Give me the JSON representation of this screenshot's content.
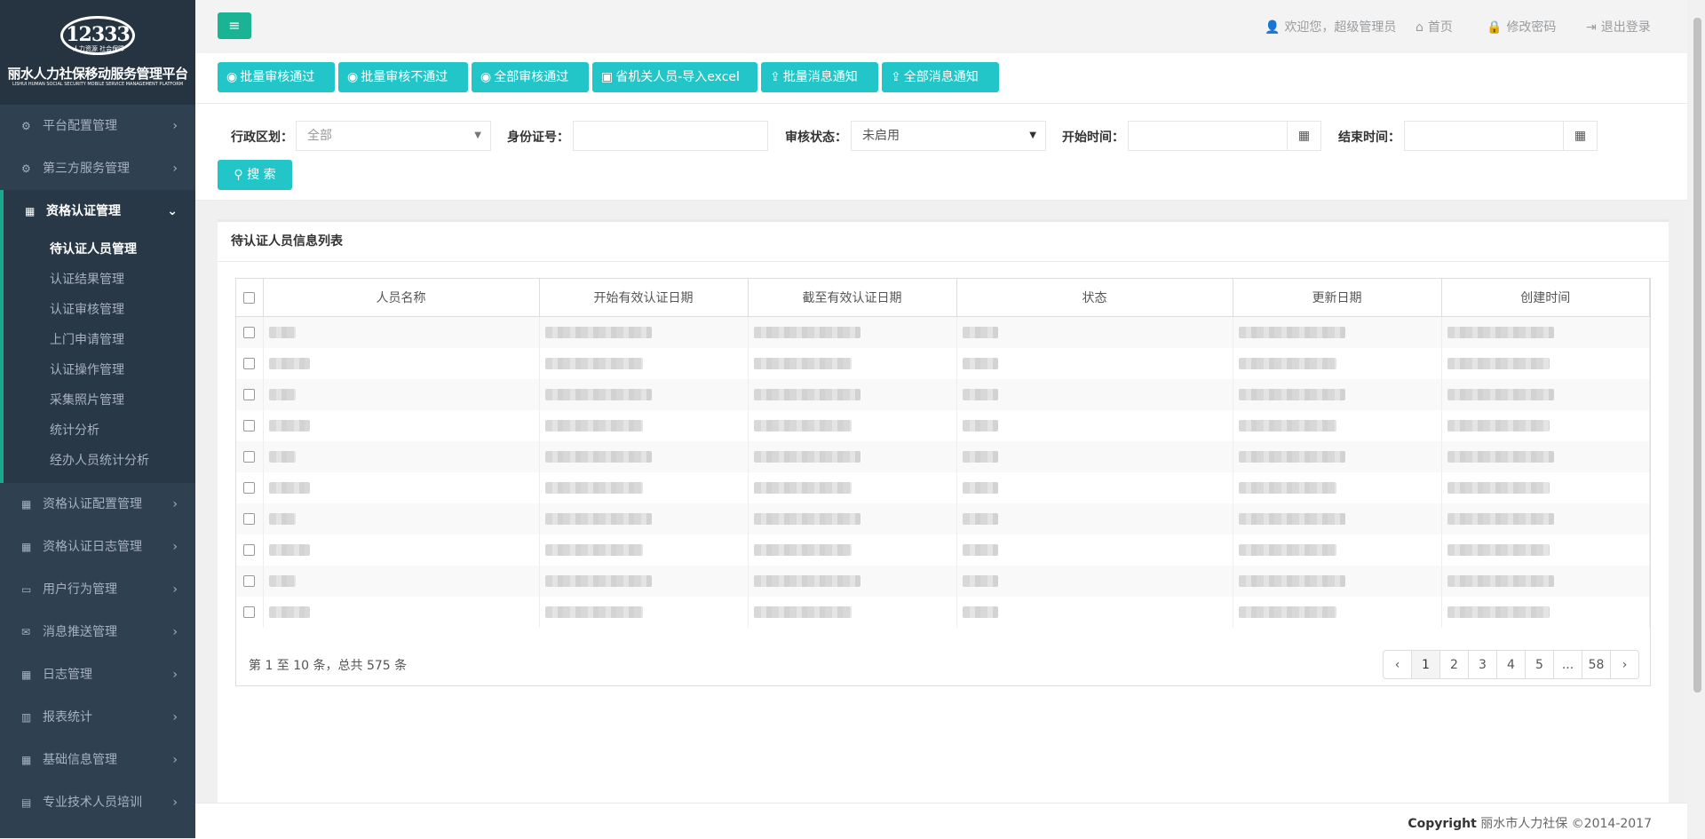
{
  "logo": {
    "number": "12333",
    "tagline": "人力资源 社会保障",
    "title": "丽水人力社保移动服务管理平台",
    "subtitle": "LISHUI HUMAN SOCIAL SECURITY MOBILE SERVICE MANAGEMENT PLATFORM"
  },
  "sidebar": {
    "items": [
      {
        "label": "平台配置管理",
        "icon": "gear-icon"
      },
      {
        "label": "第三方服务管理",
        "icon": "gears-icon"
      },
      {
        "label": "资格认证管理",
        "icon": "grid-icon"
      },
      {
        "label": "资格认证配置管理",
        "icon": "grid-icon"
      },
      {
        "label": "资格认证日志管理",
        "icon": "grid-icon"
      },
      {
        "label": "用户行为管理",
        "icon": "monitor-icon"
      },
      {
        "label": "消息推送管理",
        "icon": "envelope-icon"
      },
      {
        "label": "日志管理",
        "icon": "grid-icon"
      },
      {
        "label": "报表统计",
        "icon": "bar-chart-icon"
      },
      {
        "label": "基础信息管理",
        "icon": "grid-icon"
      },
      {
        "label": "专业技术人员培训",
        "icon": "document-icon"
      }
    ],
    "subitems": [
      "待认证人员管理",
      "认证结果管理",
      "认证审核管理",
      "上门申请管理",
      "认证操作管理",
      "采集照片管理",
      "统计分析",
      "经办人员统计分析"
    ]
  },
  "topbar": {
    "welcome": "欢迎您，超级管理员",
    "home": "首页",
    "change_password": "修改密码",
    "logout": "退出登录"
  },
  "toolbar": {
    "buttons": [
      "批量审核通过",
      "批量审核不通过",
      "全部审核通过",
      "省机关人员-导入excel",
      "批量消息通知",
      "全部消息通知"
    ]
  },
  "filter": {
    "region_label": "行政区划：",
    "region_value": "全部",
    "id_label": "身份证号：",
    "status_label": "审核状态：",
    "status_value": "未启用",
    "start_label": "开始时间：",
    "end_label": "结束时间：",
    "search_label": "搜 索"
  },
  "panel": {
    "title": "待认证人员信息列表",
    "columns": [
      "人员名称",
      "开始有效认证日期",
      "截至有效认证日期",
      "状态",
      "更新日期",
      "创建时间"
    ],
    "row_count": 10,
    "pagination_info": "第 1 至 10 条，总共 575 条",
    "pages": [
      "‹",
      "1",
      "2",
      "3",
      "4",
      "5",
      "...",
      "58",
      "›"
    ],
    "current_page": "1"
  },
  "footer": {
    "copyright_bold": "Copyright",
    "copyright_text": "丽水市人力社保 ©2014-2017"
  },
  "colors": {
    "sidebar_bg": "#2f4050",
    "accent_green": "#1ab394",
    "button_cyan": "#23c6c8"
  }
}
